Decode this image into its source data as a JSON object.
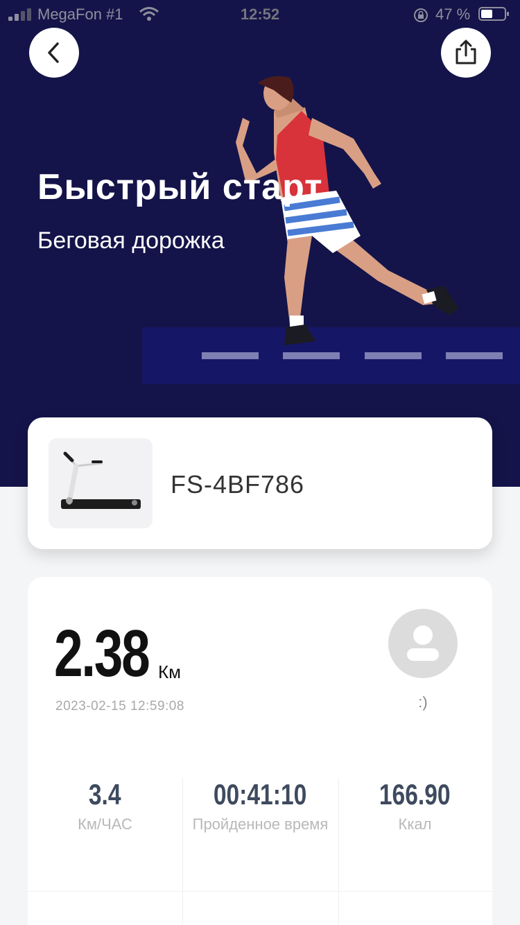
{
  "status_bar": {
    "carrier": "MegaFon #1",
    "time": "12:52",
    "battery": "47 %"
  },
  "header": {
    "title": "Быстрый старт",
    "subtitle": "Беговая дорожка"
  },
  "device": {
    "name": "FS-4BF786"
  },
  "workout": {
    "distance": "2.38",
    "distance_unit": "Км",
    "timestamp": "2023-02-15 12:59:08",
    "user_name": ":)"
  },
  "metrics": [
    {
      "value": "3.4",
      "label": "Км/ЧАС"
    },
    {
      "value": "00:41:10",
      "label": "Пройденное время"
    },
    {
      "value": "166.90",
      "label": "Ккал"
    }
  ],
  "colors": {
    "hero_bg": "#14144a",
    "metric_value": "#3e4a5e"
  }
}
